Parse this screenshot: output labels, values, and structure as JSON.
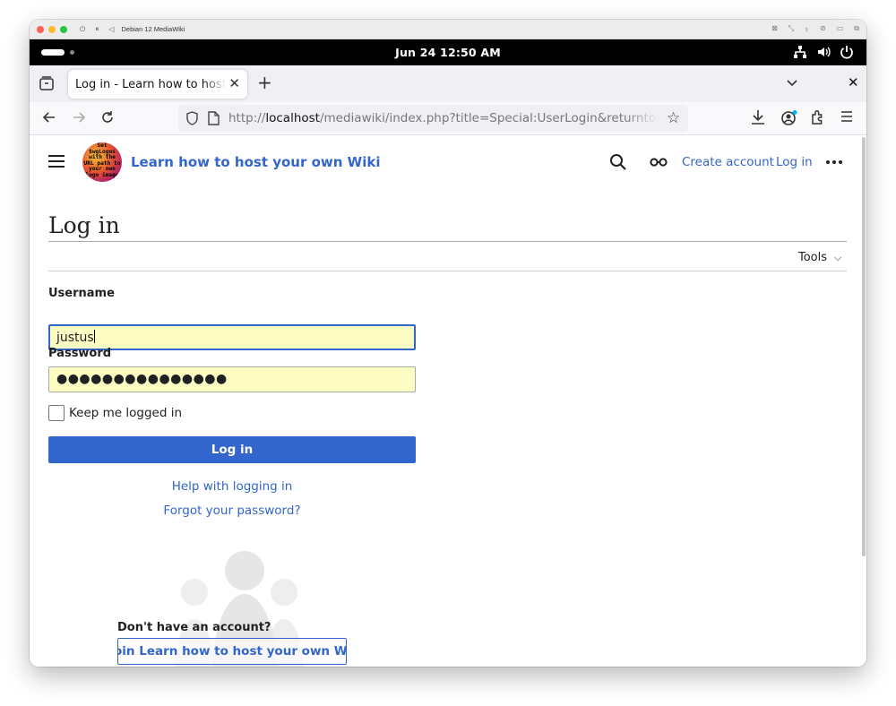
{
  "host": {
    "window_title": "Debian 12 MediaWiki"
  },
  "gnome": {
    "clock": "Jun 24  12:50 AM"
  },
  "browser": {
    "tab_title": "Log in - Learn how to host your own Wiki",
    "url_host_prefix": "http://",
    "url_host": "localhost",
    "url_path": "/mediawiki/index.php?title=Special:UserLogin&returnto=Main+Page"
  },
  "wiki": {
    "logo_text": "Set $wgLogos with the URL path to your own logo image",
    "site_title": "Learn how to host your own Wiki",
    "create_account": "Create account",
    "log_in": "Log in"
  },
  "page": {
    "title": "Log in",
    "tools_label": "Tools"
  },
  "form": {
    "username_label": "Username",
    "username_value": "justus",
    "password_label": "Password",
    "password_dots": "●●●●●●●●●●●●●●●",
    "keep_logged_in": "Keep me logged in",
    "login_button": "Log in",
    "help_link": "Help with logging in",
    "forgot_link": "Forgot your password?"
  },
  "signup": {
    "prompt": "Don't have an account?",
    "button": "Join Learn how to host your own Wiki"
  },
  "colors": {
    "accent": "#3366cc",
    "input_fill": "#fdfdc3"
  }
}
